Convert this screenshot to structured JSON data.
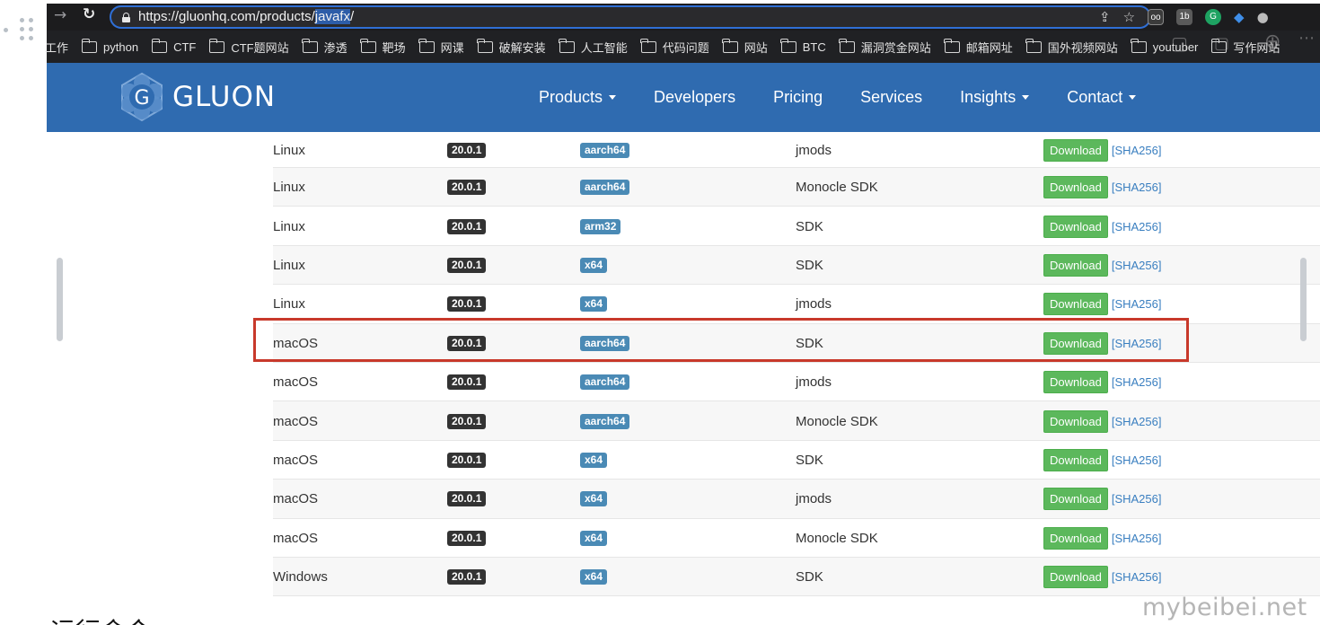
{
  "browser": {
    "url_main": "https://gluonhq.com/products/",
    "url_selected": "javafx",
    "url_end": "/",
    "bookmarks_first": "工作",
    "bookmarks": [
      "python",
      "CTF",
      "CTF题网站",
      "渗透",
      "靶场",
      "网课",
      "破解安装",
      "人工智能",
      "代码问题",
      "网站",
      "BTC",
      "漏洞赏金网站",
      "邮箱网址",
      "国外视频网站",
      "youtuber",
      "写作网站"
    ],
    "extension_labels": [
      "oo",
      "1b",
      "G"
    ],
    "icons": [
      "back-arrow-icon",
      "reload-icon",
      "lock-icon",
      "share-icon",
      "star-icon",
      "folder-icon"
    ]
  },
  "site": {
    "logo_letter": "G",
    "logo_text": "GLUON",
    "nav": [
      {
        "label": "Products",
        "dropdown": true
      },
      {
        "label": "Developers",
        "dropdown": false
      },
      {
        "label": "Pricing",
        "dropdown": false
      },
      {
        "label": "Services",
        "dropdown": false
      },
      {
        "label": "Insights",
        "dropdown": true
      },
      {
        "label": "Contact",
        "dropdown": true
      }
    ],
    "colors": {
      "header": "#2f6bb0",
      "download": "#5cb85c",
      "arch_badge": "#4a8ab5",
      "version_badge": "#333333",
      "highlight": "#c8392b"
    }
  },
  "table": {
    "download_label": "Download",
    "sha_label": "[SHA256]",
    "rows": [
      {
        "os": "Linux",
        "version": "20.0.1",
        "arch": "aarch64",
        "type": "jmods",
        "highlighted": false
      },
      {
        "os": "Linux",
        "version": "20.0.1",
        "arch": "aarch64",
        "type": "Monocle SDK",
        "highlighted": false
      },
      {
        "os": "Linux",
        "version": "20.0.1",
        "arch": "arm32",
        "type": "SDK",
        "highlighted": false
      },
      {
        "os": "Linux",
        "version": "20.0.1",
        "arch": "x64",
        "type": "SDK",
        "highlighted": false
      },
      {
        "os": "Linux",
        "version": "20.0.1",
        "arch": "x64",
        "type": "jmods",
        "highlighted": false
      },
      {
        "os": "macOS",
        "version": "20.0.1",
        "arch": "aarch64",
        "type": "SDK",
        "highlighted": true
      },
      {
        "os": "macOS",
        "version": "20.0.1",
        "arch": "aarch64",
        "type": "jmods",
        "highlighted": false
      },
      {
        "os": "macOS",
        "version": "20.0.1",
        "arch": "aarch64",
        "type": "Monocle SDK",
        "highlighted": false
      },
      {
        "os": "macOS",
        "version": "20.0.1",
        "arch": "x64",
        "type": "SDK",
        "highlighted": false
      },
      {
        "os": "macOS",
        "version": "20.0.1",
        "arch": "x64",
        "type": "jmods",
        "highlighted": false
      },
      {
        "os": "macOS",
        "version": "20.0.1",
        "arch": "x64",
        "type": "Monocle SDK",
        "highlighted": false
      },
      {
        "os": "Windows",
        "version": "20.0.1",
        "arch": "x64",
        "type": "SDK",
        "highlighted": false
      }
    ]
  },
  "page": {
    "heading_cut": "运行命令:",
    "watermark": "mybeibei.net"
  }
}
